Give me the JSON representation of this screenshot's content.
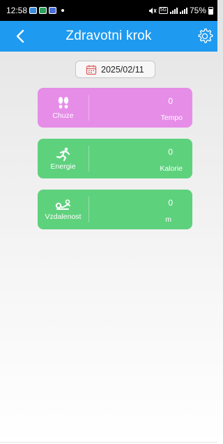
{
  "status_bar": {
    "time": "12:58",
    "battery": "75%",
    "network_badge": "5G"
  },
  "header": {
    "title": "Zdravotni krok",
    "back_icon": "chevron-left-icon",
    "settings_icon": "gear-icon",
    "color": "#1e9af0"
  },
  "date": {
    "value": "2025/02/11",
    "icon": "calendar-icon",
    "icon_color": "#e25c5c"
  },
  "cards": [
    {
      "id": "walk",
      "icon": "footprints-icon",
      "label": "Chuze",
      "value": "0",
      "unit": "Tempo",
      "color": "#e68de8"
    },
    {
      "id": "energy",
      "icon": "running-icon",
      "label": "Energie",
      "value": "0",
      "unit": "Kalorie",
      "color": "#5ed17d"
    },
    {
      "id": "distance",
      "icon": "distance-icon",
      "label": "Vzdalenost",
      "value": "0",
      "unit": "m",
      "color": "#5ed17d"
    }
  ]
}
